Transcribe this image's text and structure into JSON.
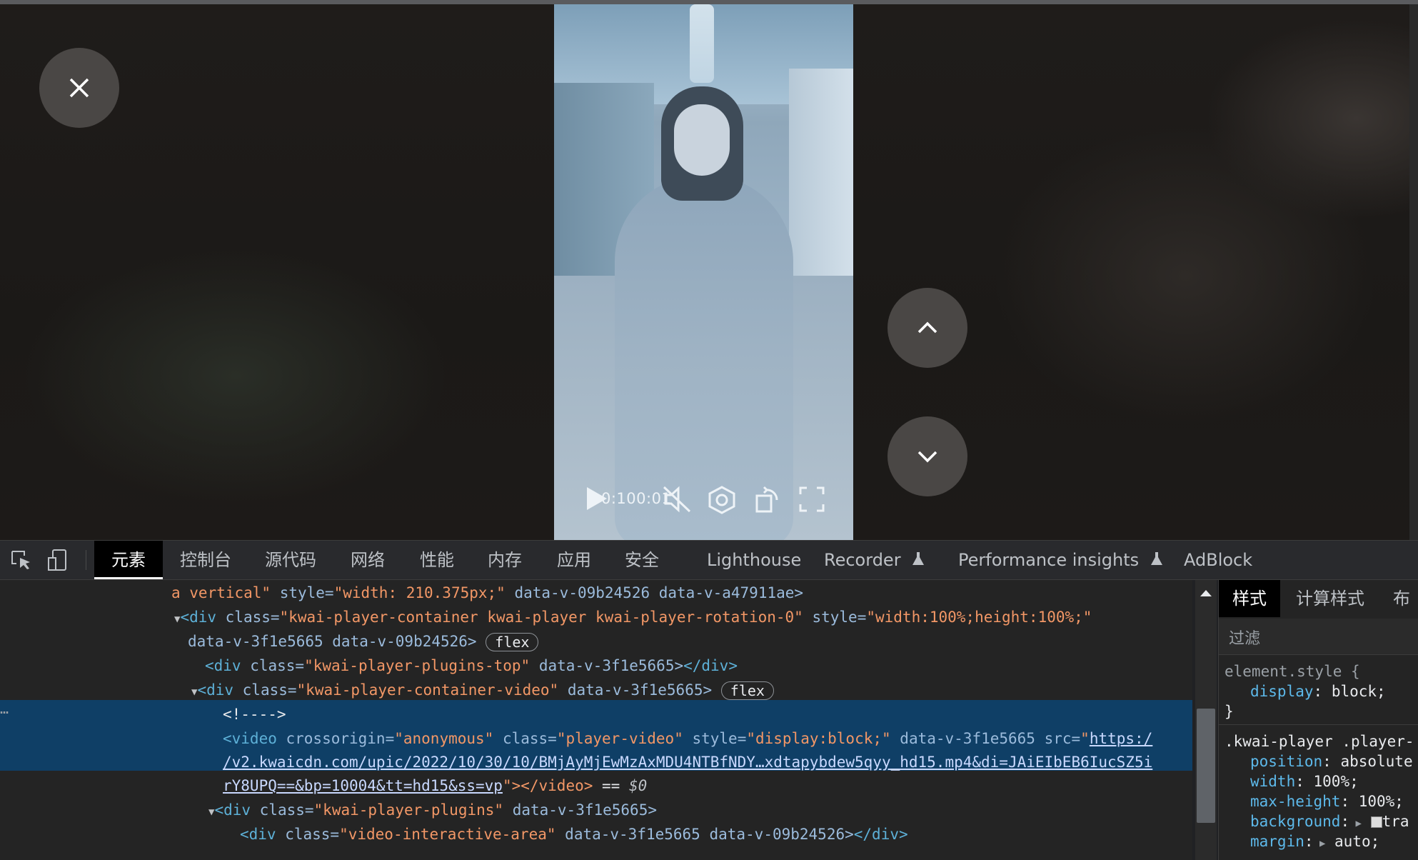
{
  "video_player": {
    "time": "0:100:01",
    "close_label": "×"
  },
  "devtools": {
    "tabs": [
      "元素",
      "控制台",
      "源代码",
      "网络",
      "性能",
      "内存",
      "应用",
      "安全",
      "Lighthouse",
      "Recorder",
      "Performance insights",
      "AdBlock"
    ],
    "active_tab": "元素",
    "elements_lines": {
      "l0_a": "a vertical\"",
      "l0_b": " style=",
      "l0_c": "\"width: 210.375px;\"",
      "l0_d": " data-v-09b24526 data-v-a47911ae>",
      "l1_tag": "<div",
      "l1_attr": " class=",
      "l1_val": "\"kwai-player-container kwai-player kwai-player-rotation-0\"",
      "l1_attr2": " style=",
      "l1_val2": "\"width:100%;height:100%;\"",
      "l2": "data-v-3f1e5665 data-v-09b24526>",
      "badge": "flex",
      "l3_tag": "<div",
      "l3_attr": " class=",
      "l3_val": "\"kwai-player-plugins-top\"",
      "l3_rest": " data-v-3f1e5665>",
      "l3_close": "</div>",
      "l4_tag": "<div",
      "l4_attr": " class=",
      "l4_val": "\"kwai-player-container-video\"",
      "l4_rest": " data-v-3f1e5665>",
      "l5": "<!---->",
      "l6_tag": "<video",
      "l6_a1": " crossorigin=",
      "l6_v1": "\"anonymous\"",
      "l6_a2": " class=",
      "l6_v2": "\"player-video\"",
      "l6_a3": " style=",
      "l6_v3": "\"display:block;\"",
      "l6_a4": " data-v-3f1e5665 src=",
      "l6_q": "\"",
      "l6_link": "https:/",
      "l7_link": "/v2.kwaicdn.com/upic/2022/10/30/10/BMjAyMjEwMzAxMDU4NTBfNDY…xdtapybdew5qyy_hd15.mp4&di=JAiEIbEB6IucSZ5i",
      "l8_link": "rY8UPQ==&bp=10004&tt=hd15&ss=vp",
      "l8_end": "\"></video>",
      "l8_eq": " == ",
      "l8_dollar": "$0",
      "l9_tag": "<div",
      "l9_attr": " class=",
      "l9_val": "\"kwai-player-plugins\"",
      "l9_rest": " data-v-3f1e5665>",
      "l10_tag": "<div",
      "l10_attr": " class=",
      "l10_val": "\"video-interactive-area\"",
      "l10_rest": " data-v-3f1e5665 data-v-09b24526>",
      "l10_close": "</div>",
      "ellipsis": "…"
    },
    "styles": {
      "tabs": [
        "样式",
        "计算样式",
        "布局"
      ],
      "filter_placeholder": "过滤",
      "element_style": "element.style {",
      "display_prop": "display",
      "display_val": "block;",
      "close_brace": "}",
      "rule_selector": ".kwai-player .player-",
      "p1": "position",
      "v1": "absolute",
      "p2": "width",
      "v2": "100%;",
      "p3": "max-height",
      "v3": "100%;",
      "p4": "background",
      "v4": "tra",
      "p5": "margin",
      "v5": "auto;"
    }
  }
}
